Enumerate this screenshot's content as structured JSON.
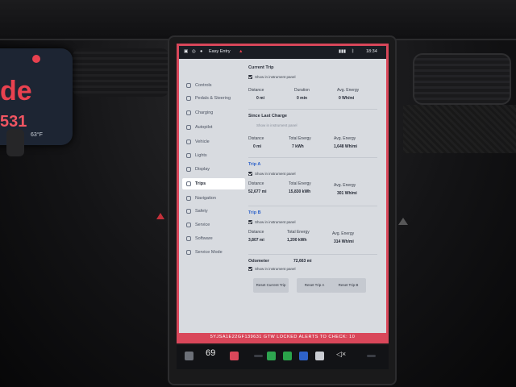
{
  "cluster": {
    "gear_text": "de",
    "number_text": "531",
    "outside_temp": "63°F"
  },
  "statusbar": {
    "profile": "Easy Entry",
    "time": "18:34"
  },
  "sidebar": {
    "items": [
      {
        "label": "Controls",
        "icon": "toggle-icon",
        "active": false
      },
      {
        "label": "Pedals & Steering",
        "icon": "car-icon",
        "active": false
      },
      {
        "label": "Charging",
        "icon": "bolt-icon",
        "active": false
      },
      {
        "label": "Autopilot",
        "icon": "steering-icon",
        "active": false
      },
      {
        "label": "Vehicle",
        "icon": "sliders-icon",
        "active": false
      },
      {
        "label": "Lights",
        "icon": "light-icon",
        "active": false
      },
      {
        "label": "Display",
        "icon": "display-icon",
        "active": false
      },
      {
        "label": "Trips",
        "icon": "trip-icon",
        "active": true
      },
      {
        "label": "Navigation",
        "icon": "navigation-icon",
        "active": false
      },
      {
        "label": "Safety",
        "icon": "safety-icon",
        "active": false
      },
      {
        "label": "Service",
        "icon": "wrench-icon",
        "active": false
      },
      {
        "label": "Software",
        "icon": "download-icon",
        "active": false
      },
      {
        "label": "Service Mode",
        "icon": "wrench-icon",
        "active": false
      }
    ]
  },
  "trips": {
    "current": {
      "title": "Current Trip",
      "show_label": "Show in instrument panel",
      "distance_label": "Distance",
      "distance": "0 mi",
      "duration_label": "Duration",
      "duration": "0 min",
      "avg_label": "Avg. Energy",
      "avg": "0 Wh/mi"
    },
    "since_charge": {
      "title": "Since Last Charge",
      "show_label": "Show in instrument panel",
      "distance_label": "Distance",
      "distance": "0 mi",
      "energy_label": "Total Energy",
      "energy": "7 kWh",
      "avg_label": "Avg. Energy",
      "avg": "1,648 Wh/mi"
    },
    "trip_a": {
      "title": "Trip A",
      "show_label": "Show in instrument panel",
      "distance_label": "Distance",
      "distance": "52,677 mi",
      "energy_label": "Total Energy",
      "energy": "15,830 kWh",
      "avg_label": "Avg. Energy",
      "avg": "301 Wh/mi"
    },
    "trip_b": {
      "title": "Trip B",
      "show_label": "Show in instrument panel",
      "distance_label": "Distance",
      "distance": "3,807 mi",
      "energy_label": "Total Energy",
      "energy": "1,200 kWh",
      "avg_label": "Avg. Energy",
      "avg": "314 Wh/mi"
    },
    "odometer": {
      "label": "Odometer",
      "value": "72,663 mi",
      "show_label": "Show in instrument panel"
    },
    "buttons": {
      "reset_current": "Reset Current Trip",
      "reset_a": "Reset Trip A",
      "reset_b": "Reset Trip B"
    }
  },
  "footer": {
    "text": "5YJSA1E22GF139631   GTW LOCKED   ALERTS TO CHECK: 10"
  },
  "dock": {
    "temperature": "69"
  },
  "colors": {
    "alert_red": "#d9475a",
    "accent_blue": "#2e62c9",
    "screen_bg": "#d8dbe0"
  }
}
